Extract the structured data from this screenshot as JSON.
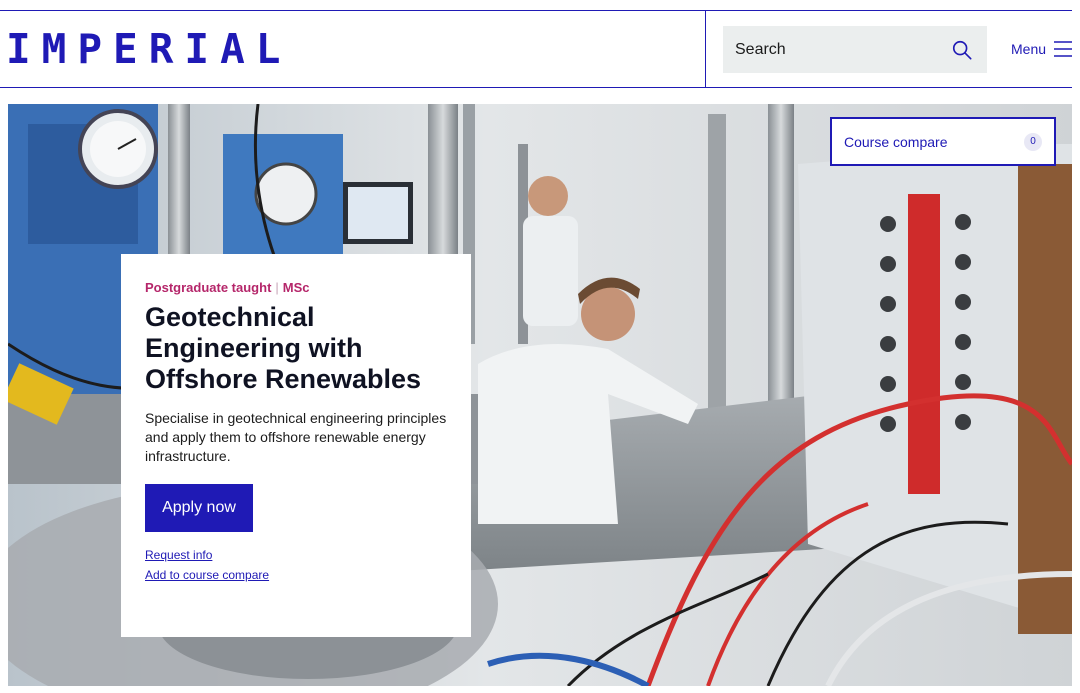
{
  "header": {
    "logo_text": "IMPERIAL",
    "search": {
      "label": "Search"
    },
    "menu_label": "Menu"
  },
  "course_compare": {
    "label": "Course compare",
    "count": "0"
  },
  "hero_card": {
    "course_type": "Postgraduate taught",
    "separator": "|",
    "level": "MSc",
    "title": "Geotechnical Engineering with Offshore Renewables",
    "description": "Specialise in geotechnical engineering principles and apply them to offshore renewable energy infrastructure.",
    "apply_label": "Apply now",
    "request_info_label": "Request info",
    "add_compare_label": "Add to course compare"
  },
  "colors": {
    "brand_blue": "#1f1ab5",
    "eyebrow_magenta": "#b5266a",
    "search_bg": "#ebeeee"
  },
  "icons": {
    "search": "search-icon",
    "menu": "hamburger-icon"
  }
}
